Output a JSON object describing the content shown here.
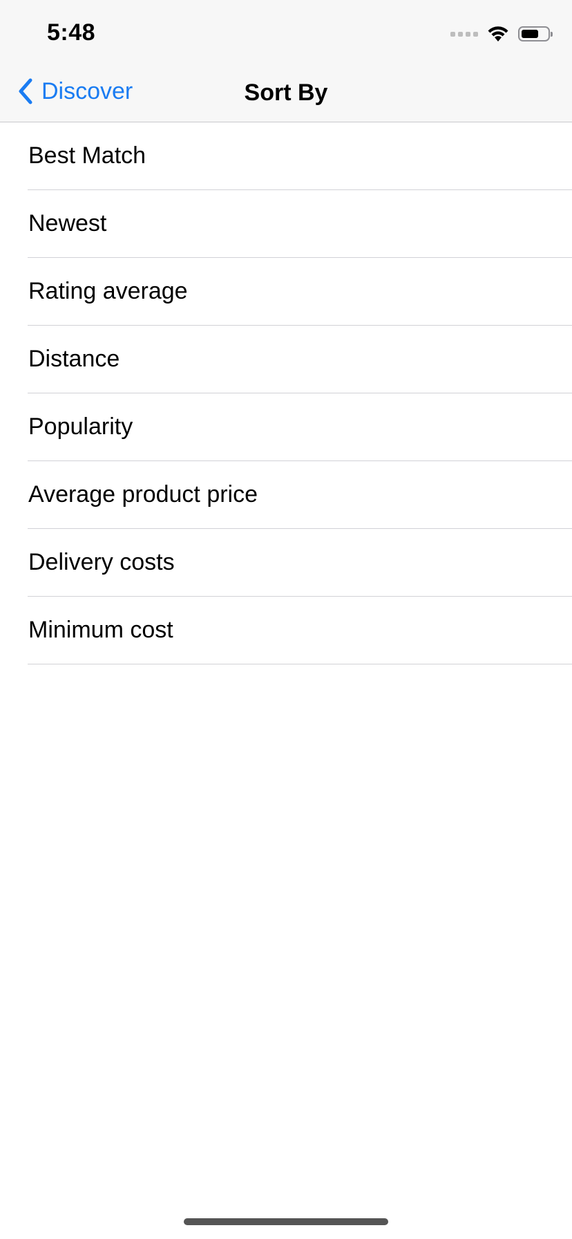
{
  "status_bar": {
    "time": "5:48",
    "icons": [
      "signal-icon",
      "wifi-icon",
      "battery-icon"
    ],
    "battery_level": 0.6
  },
  "nav": {
    "back_label": "Discover",
    "back_icon": "chevron-left-icon",
    "title": "Sort By",
    "accent_color": "#1a7cf2"
  },
  "sort_options": [
    "Best Match",
    "Newest",
    "Rating average",
    "Distance",
    "Popularity",
    "Average product price",
    "Delivery costs",
    "Minimum cost"
  ]
}
